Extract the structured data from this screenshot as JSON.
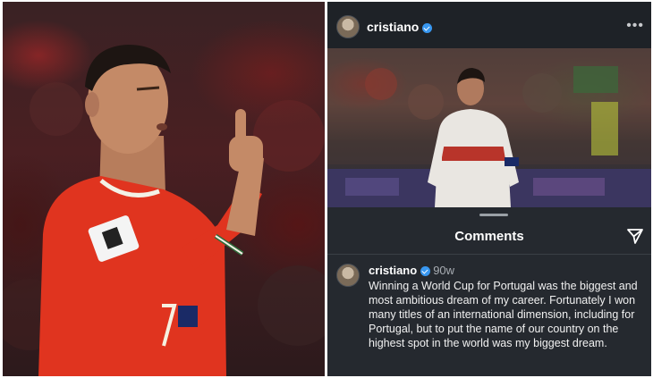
{
  "post": {
    "username": "cristiano",
    "verified": true
  },
  "comments_sheet": {
    "title": "Comments",
    "comment": {
      "username": "cristiano",
      "time": "90w",
      "text": "Winning a World Cup for Portugal was the biggest and most ambitious dream of my career. Fortunately I won many titles of an international dimension, including for Portugal, but to put the name of our country on the highest spot in the world was my biggest dream."
    }
  },
  "colors": {
    "jersey_red": "#e0341f",
    "verified_blue": "#3897f0",
    "panel_dark": "#25292f"
  },
  "icons": [
    "more-icon",
    "verified-icon",
    "share-icon"
  ]
}
